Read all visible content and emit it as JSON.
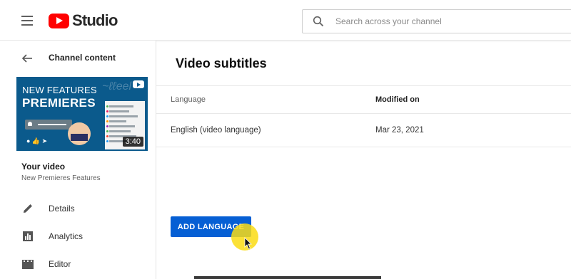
{
  "header": {
    "app_name": "Studio",
    "search": {
      "placeholder": "Search across your channel",
      "value": ""
    }
  },
  "sidebar": {
    "back_label": "Channel content",
    "thumbnail": {
      "line1": "NEW FEATURES",
      "line2": "PREMIERES",
      "duration": "3:40"
    },
    "your_video_label": "Your video",
    "video_name": "New Premieres Features",
    "nav": [
      {
        "label": "Details",
        "icon": "pencil-icon"
      },
      {
        "label": "Analytics",
        "icon": "bar-chart-icon"
      },
      {
        "label": "Editor",
        "icon": "film-icon"
      }
    ]
  },
  "main": {
    "title": "Video subtitles",
    "columns": {
      "language": "Language",
      "modified": "Modified on"
    },
    "rows": [
      {
        "language": "English (video language)",
        "modified": "Mar 23, 2021"
      }
    ],
    "add_button_label": "ADD LANGUAGE"
  },
  "colors": {
    "brand_red": "#ff0000",
    "primary_blue": "#065fd4",
    "cursor_highlight": "#fadc14"
  }
}
